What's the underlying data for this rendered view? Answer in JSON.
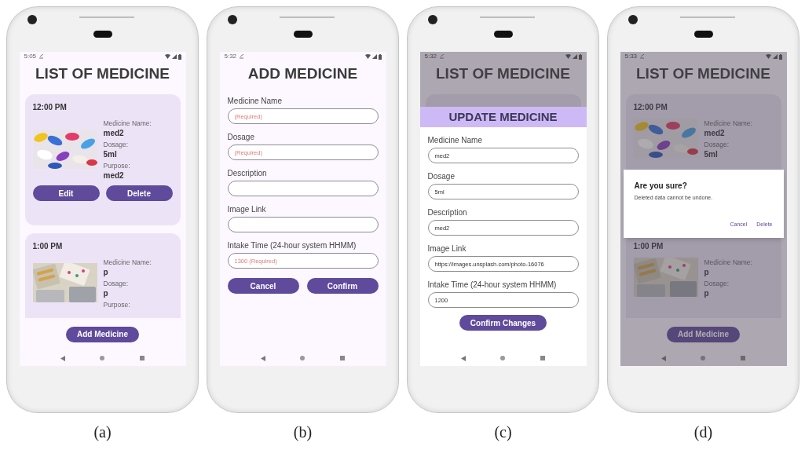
{
  "phones": [
    {
      "caption": "(a)",
      "screen": {
        "kind": "list",
        "status_time": "5:05",
        "dimmed": false,
        "title": "LIST OF MEDICINE",
        "cards": [
          {
            "time": "12:00 PM",
            "fields": [
              {
                "label": "Medicine Name:",
                "value": "med2"
              },
              {
                "label": "Dosage:",
                "value": "5ml"
              },
              {
                "label": "Purpose:",
                "value": "med2"
              }
            ],
            "buttons": [
              "Edit",
              "Delete"
            ]
          },
          {
            "time": "1:00 PM",
            "fields": [
              {
                "label": "Medicine Name:",
                "value": "p"
              },
              {
                "label": "Dosage:",
                "value": "p"
              },
              {
                "label": "Purpose:"
              }
            ]
          }
        ],
        "bottom_button": "Add Medicine"
      }
    },
    {
      "caption": "(b)",
      "screen": {
        "kind": "form",
        "status_time": "5:32",
        "dimmed": false,
        "title": "ADD MEDICINE",
        "fields": [
          {
            "label": "Medicine Name",
            "placeholder": "(Required)"
          },
          {
            "label": "Dosage",
            "placeholder": "(Required)"
          },
          {
            "label": "Description"
          },
          {
            "label": "Image Link"
          },
          {
            "label": "Intake Time (24-hour system HHMM)",
            "placeholder": "1300 (Required)"
          }
        ],
        "buttons": [
          "Cancel",
          "Confirm"
        ]
      }
    },
    {
      "caption": "(c)",
      "screen": {
        "kind": "list",
        "status_time": "5:32",
        "dimmed": true,
        "title": "LIST OF MEDICINE",
        "sheet": {
          "title": "UPDATE MEDICINE",
          "fields": [
            {
              "label": "Medicine Name",
              "value": "med2"
            },
            {
              "label": "Dosage",
              "value": "5ml"
            },
            {
              "label": "Description",
              "value": "med2"
            },
            {
              "label": "Image Link",
              "value": "https://images.unsplash.com/photo-16076"
            },
            {
              "label": "Intake Time (24-hour system HHMM)",
              "value": "1200"
            }
          ],
          "button": "Confirm Changes"
        }
      }
    },
    {
      "caption": "(d)",
      "screen": {
        "kind": "list",
        "status_time": "5:33",
        "dimmed": true,
        "title": "LIST OF MEDICINE",
        "cards": [
          {
            "time": "12:00 PM",
            "fields": [
              {
                "label": "Medicine Name:",
                "value": "med2"
              },
              {
                "label": "Dosage:",
                "value": "5ml"
              }
            ]
          },
          {
            "time": "1:00 PM",
            "fields": [
              {
                "label": "Medicine Name:",
                "value": "p"
              },
              {
                "label": "Dosage:",
                "value": "p"
              }
            ]
          }
        ],
        "bottom_button": "Add Medicine",
        "dialog": {
          "title": "Are you sure?",
          "message": "Deleted data cannot be undone.",
          "buttons": [
            "Cancel",
            "Delete"
          ]
        }
      }
    }
  ]
}
